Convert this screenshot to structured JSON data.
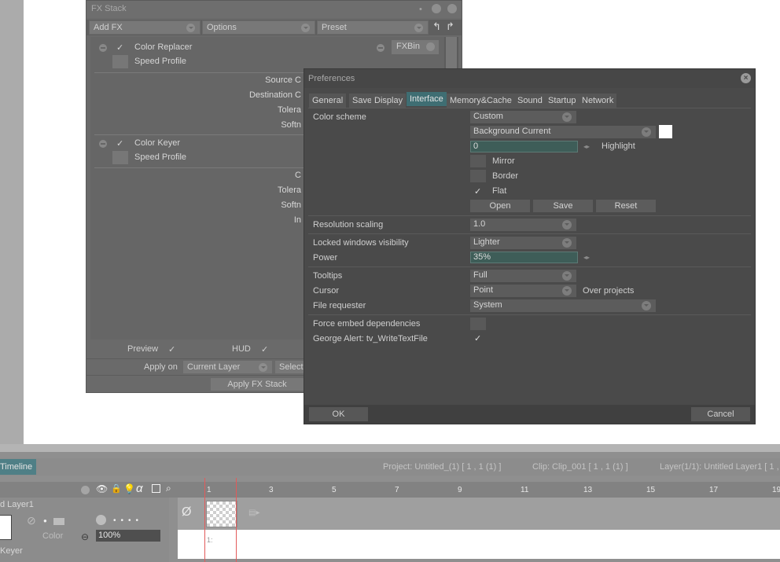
{
  "fx_stack": {
    "title": "FX Stack",
    "toolbar": {
      "add_fx": "Add FX",
      "options": "Options",
      "preset": "Preset"
    },
    "fxbin": "FXBin",
    "effects": [
      {
        "name": "Color Replacer",
        "check": "✓",
        "sub": "Speed Profile",
        "params": [
          "Source C",
          "Destination C",
          "Tolera",
          "Softn"
        ]
      },
      {
        "name": "Color Keyer",
        "check": "✓",
        "sub": "Speed Profile",
        "params": [
          "C",
          "Tolera",
          "Softn",
          "In"
        ]
      }
    ],
    "footer": {
      "preview_label": "Preview",
      "preview_check": "✓",
      "hud_label": "HUD",
      "hud_check": "✓",
      "apply_on_label": "Apply on",
      "apply_on_value": "Current Layer",
      "selection_label": "Selecti",
      "apply_button": "Apply FX Stack"
    }
  },
  "preferences": {
    "title": "Preferences",
    "tabs": [
      "General",
      "Save",
      "Display",
      "Interface",
      "Memory&Cache",
      "Sound",
      "Startup",
      "Network"
    ],
    "active_tab": "Interface",
    "color_scheme": {
      "label": "Color scheme",
      "value": "Custom",
      "background": "Background Current",
      "swatch_color": "#ffffff",
      "field_value": "0",
      "highlight_label": "Highlight",
      "mirror": "Mirror",
      "border": "Border",
      "flat": "Flat",
      "flat_check": "✓",
      "open": "Open",
      "save": "Save",
      "reset": "Reset"
    },
    "resolution_scaling": {
      "label": "Resolution scaling",
      "value": "1.0"
    },
    "locked_windows": {
      "label": "Locked windows visibility",
      "value": "Lighter"
    },
    "power": {
      "label": "Power",
      "value": "35%"
    },
    "tooltips": {
      "label": "Tooltips",
      "value": "Full"
    },
    "cursor": {
      "label": "Cursor",
      "value": "Point",
      "extra": "Over projects"
    },
    "file_requester": {
      "label": "File requester",
      "value": "System"
    },
    "force_embed": {
      "label": "Force embed dependencies"
    },
    "george_alert": {
      "label": "George Alert: tv_WriteTextFile",
      "check": "✓"
    },
    "ok": "OK",
    "cancel": "Cancel"
  },
  "timeline": {
    "tab": "Timeline",
    "project": "Project: Untitled_(1) [ 1 , 1  (1) ]",
    "clip": "Clip: Clip_001 [ 1 , 1  (1) ]",
    "layer": "Layer(1/1): Untitled Layer1 [ 1 ,",
    "ruler": [
      "1",
      "3",
      "5",
      "7",
      "9",
      "11",
      "13",
      "15",
      "17",
      "19"
    ],
    "layer_name": "d Layer1",
    "color_label": "Color",
    "opacity": "100%",
    "keyer_label": "Keyer",
    "frame_label": "1:"
  },
  "colors": {
    "accent": "#3f6e73",
    "timeline_tab": "#4f7f86",
    "playhead": "#e25a5a"
  }
}
